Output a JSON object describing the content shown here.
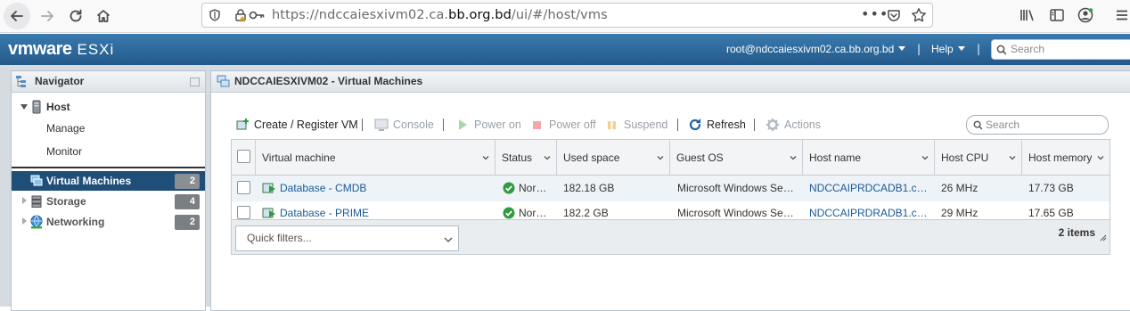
{
  "browser": {
    "url_prefix": "https://ndccaiesxivm02.ca.",
    "url_domain": "bb.org.bd",
    "url_suffix": "/ui/#/host/vms",
    "more": "•••"
  },
  "header": {
    "brand_vm": "vmware",
    "brand_product": "ESXi",
    "user": "root@ndccaiesxivm02.ca.bb.org.bd",
    "help": "Help",
    "separator": "|",
    "search_placeholder": "Search"
  },
  "navigator": {
    "title": "Navigator",
    "host": {
      "label": "Host",
      "children": [
        "Manage",
        "Monitor"
      ]
    },
    "items": [
      {
        "label": "Virtual Machines",
        "count": "2"
      },
      {
        "label": "Storage",
        "count": "4"
      },
      {
        "label": "Networking",
        "count": "2"
      }
    ]
  },
  "main": {
    "title": "NDCCAIESXIVM02 - Virtual Machines",
    "toolbar": {
      "create": "Create / Register VM",
      "console": "Console",
      "power_on": "Power on",
      "power_off": "Power off",
      "suspend": "Suspend",
      "refresh": "Refresh",
      "actions": "Actions",
      "separator": "|",
      "search_placeholder": "Search"
    },
    "columns": [
      "Virtual machine",
      "Status",
      "Used space",
      "Guest OS",
      "Host name",
      "Host CPU",
      "Host memory"
    ],
    "rows": [
      {
        "name": "Database - CMDB",
        "status": "Nor…",
        "used_space": "182.18 GB",
        "guest_os": "Microsoft Windows Se…",
        "host_name": "NDCCAIPRDCADB1.c…",
        "host_cpu": "26 MHz",
        "host_memory": "17.73 GB"
      },
      {
        "name": "Database - PRIME",
        "status": "Nor…",
        "used_space": "182.2 GB",
        "guest_os": "Microsoft Windows Se…",
        "host_name": "NDCCAIPRDRADB1.c…",
        "host_cpu": "29 MHz",
        "host_memory": "17.65 GB"
      }
    ],
    "quick_filters": "Quick filters...",
    "item_count": "2 items"
  },
  "colors": {
    "header_blue": "#2b6698",
    "selection_blue": "#1f4e79",
    "link_blue": "#1a5a96",
    "status_green": "#2e9b3e"
  }
}
